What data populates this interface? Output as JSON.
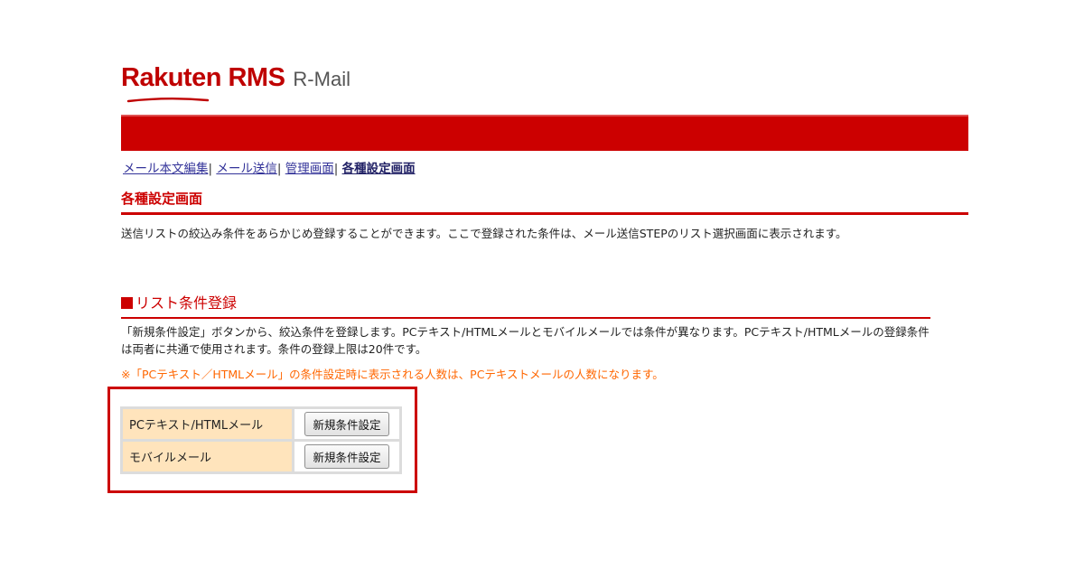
{
  "logo": {
    "brand": "Rakuten RMS",
    "product": "R-Mail",
    "brand_color": "#bf0000"
  },
  "header_bar": {
    "color": "#cc0000"
  },
  "nav": {
    "items": [
      {
        "label": "メール本文編集"
      },
      {
        "label": "メール送信"
      },
      {
        "label": "管理画面"
      },
      {
        "label": "各種設定画面"
      }
    ],
    "separator": "|"
  },
  "page": {
    "title": "各種設定画面",
    "description": "送信リストの絞込み条件をあらかじめ登録することができます。ここで登録された条件は、メール送信STEPのリスト選択画面に表示されます。"
  },
  "section": {
    "title": "リスト条件登録",
    "description": "「新規条件設定」ボタンから、絞込条件を登録します。PCテキスト/HTMLメールとモバイルメールでは条件が異なります。PCテキスト/HTMLメールの登録条件は両者に共通で使用されます。条件の登録上限は20件です。",
    "note": "※「PCテキスト／HTMLメール」の条件設定時に表示される人数は、PCテキストメールの人数になります。",
    "note_color": "#ff6600"
  },
  "conditions": {
    "rows": [
      {
        "label": "PCテキスト/HTMLメール",
        "button": "新規条件設定"
      },
      {
        "label": "モバイルメール",
        "button": "新規条件設定"
      }
    ],
    "label_bg": "#ffe4bc"
  }
}
